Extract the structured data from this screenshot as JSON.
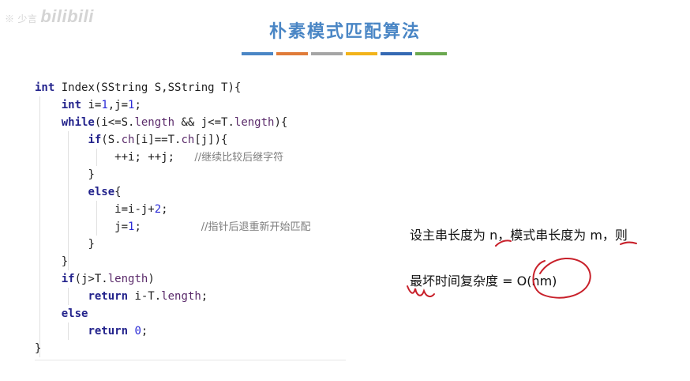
{
  "watermark": {
    "small": "※ 少言",
    "brand": "bilibili"
  },
  "slide": {
    "title": "朴素模式匹配算法",
    "accent_colors": [
      "#4a86c5",
      "#e07b39",
      "#a5a5a5",
      "#f2b31a",
      "#3569b3",
      "#6aa84f"
    ]
  },
  "code": {
    "l1": {
      "kw": "int",
      "rest": " Index(SString S,SString T){"
    },
    "l2": {
      "kw": "int",
      "a": " i=",
      "n1": "1",
      "b": ",j=",
      "n2": "1",
      "c": ";"
    },
    "l3": {
      "kw": "while",
      "a": "(i<=S.",
      "f1": "length",
      "b": " && j<=T.",
      "f2": "length",
      "c": "){"
    },
    "l4": {
      "kw": "if",
      "a": "(S.",
      "f1": "ch",
      "b": "[i]==T.",
      "f2": "ch",
      "c": "[j]){"
    },
    "l5": {
      "a": "++i; ++j;",
      "cmt": "//继续比较后继字符"
    },
    "l6": {
      "a": "}"
    },
    "l7": {
      "kw": "else",
      "a": "{"
    },
    "l8": {
      "a": "i=i-j+",
      "n": "2",
      "b": ";"
    },
    "l9": {
      "a": "j=",
      "n": "1",
      "b": ";",
      "cmt": "//指针后退重新开始匹配"
    },
    "l10": {
      "a": "}"
    },
    "l11": {
      "a": "}"
    },
    "l12": {
      "kw": "if",
      "a": "(j>T.",
      "f": "length",
      "b": ")"
    },
    "l13": {
      "kw": "return",
      "a": " i-T.",
      "f": "length",
      "b": ";"
    },
    "l14": {
      "kw": "else"
    },
    "l15": {
      "kw": "return",
      "n": " 0",
      "b": ";"
    },
    "l16": {
      "a": "}"
    }
  },
  "notes": {
    "line1": "设主串长度为 n，模式串长度为 m，则",
    "line2_label": "最坏时间复杂度 = ",
    "line2_value": "O(nm)"
  },
  "annotation_color": "#c8202a"
}
